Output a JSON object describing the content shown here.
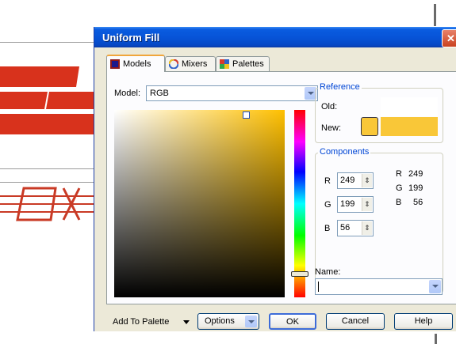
{
  "window": {
    "title": "Uniform Fill",
    "close_icon": "close-icon"
  },
  "tabs": [
    {
      "label": "Models",
      "icon": "models-icon",
      "active": true
    },
    {
      "label": "Mixers",
      "icon": "mixers-icon",
      "active": false
    },
    {
      "label": "Palettes",
      "icon": "palettes-icon",
      "active": false
    }
  ],
  "model": {
    "label": "Model:",
    "value": "RGB"
  },
  "reference": {
    "title": "Reference",
    "old_label": "Old:",
    "new_label": "New:",
    "old_color": "#ffffff",
    "new_color": "#f9c738"
  },
  "components": {
    "title": "Components",
    "inputs": [
      {
        "channel": "R",
        "value": "249"
      },
      {
        "channel": "G",
        "value": "199"
      },
      {
        "channel": "B",
        "value": "56"
      }
    ],
    "readouts": [
      {
        "channel": "R",
        "value": "249"
      },
      {
        "channel": "G",
        "value": "199"
      },
      {
        "channel": "B",
        "value": "56"
      }
    ]
  },
  "name": {
    "label": "Name:",
    "value": ""
  },
  "buttons": {
    "add_to_palette": "Add To Palette",
    "options": "Options",
    "ok": "OK",
    "cancel": "Cancel",
    "help": "Help"
  },
  "colors": {
    "hue_color": "#ffc000",
    "selected": "#f9c738",
    "title_bar": "#0754d8",
    "logo_red": "#d8321c"
  }
}
